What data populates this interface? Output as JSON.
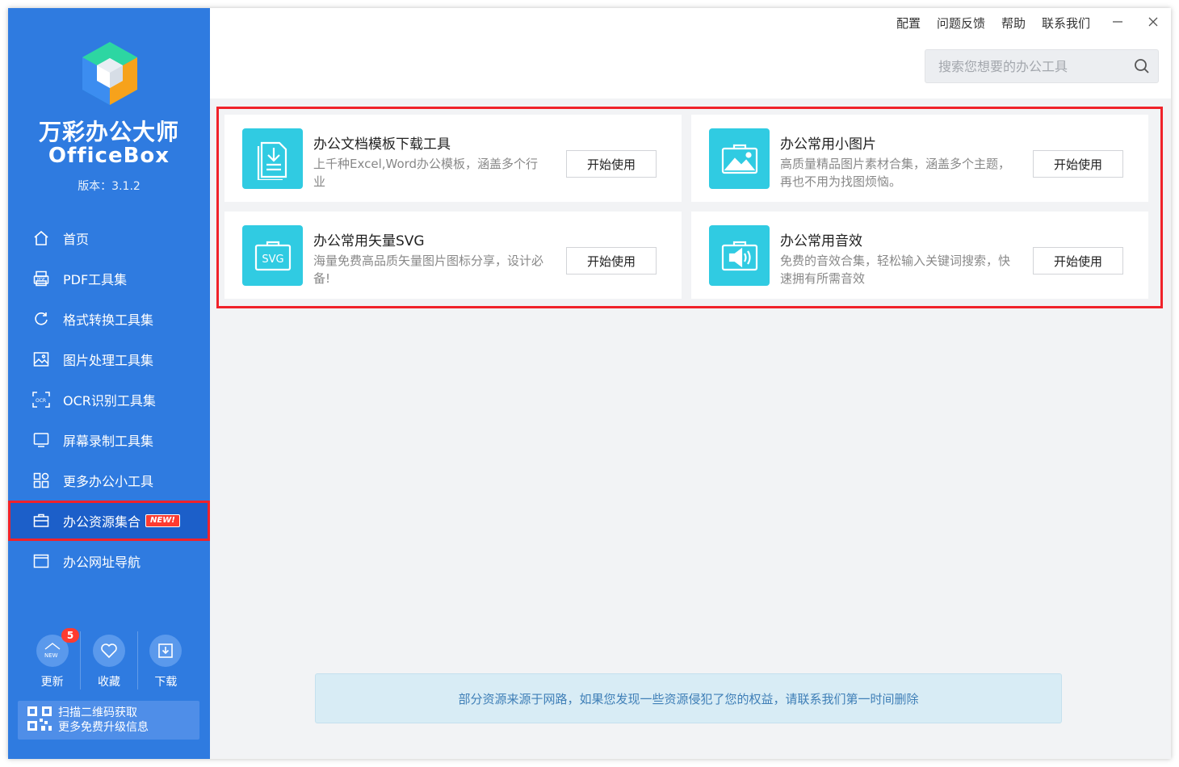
{
  "app": {
    "name_cn": "万彩办公大师",
    "name_en": "OfficeBox",
    "version": "版本：3.1.2"
  },
  "colors": {
    "sidebar": "#2f7be0",
    "sidebar_active": "#1c5fc9",
    "highlight_border": "#f0222a",
    "card_icon": "#30cbe2",
    "notice_bg": "#d8ecf5"
  },
  "sidebar": {
    "items": [
      {
        "label": "首页",
        "icon": "home-icon"
      },
      {
        "label": "PDF工具集",
        "icon": "pdf-icon"
      },
      {
        "label": "格式转换工具集",
        "icon": "convert-icon"
      },
      {
        "label": "图片处理工具集",
        "icon": "image-icon"
      },
      {
        "label": "OCR识别工具集",
        "icon": "ocr-icon"
      },
      {
        "label": "屏幕录制工具集",
        "icon": "screen-record-icon"
      },
      {
        "label": "更多办公小工具",
        "icon": "more-tools-icon"
      },
      {
        "label": "办公资源集合",
        "icon": "briefcase-icon",
        "active": true,
        "badge": "NEW!"
      },
      {
        "label": "办公网址导航",
        "icon": "browser-icon"
      }
    ],
    "bottom": {
      "update_label": "更新",
      "update_icon_text": "NEW",
      "update_count": "5",
      "favorite_label": "收藏",
      "download_label": "下载"
    },
    "qr": {
      "line1": "扫描二维码获取",
      "line2": "更多免费升级信息"
    }
  },
  "topbar": {
    "menu": [
      "配置",
      "问题反馈",
      "帮助",
      "联系我们"
    ],
    "search_placeholder": "搜索您想要的办公工具"
  },
  "cards": [
    {
      "title": "办公文档模板下载工具",
      "desc": "上千种Excel,Word办公模板，涵盖多个行业",
      "button": "开始使用",
      "icon": "document-download-icon"
    },
    {
      "title": "办公常用小图片",
      "desc": "高质量精品图片素材合集，涵盖多个主题，再也不用为找图烦恼。",
      "button": "开始使用",
      "icon": "picture-icon"
    },
    {
      "title": "办公常用矢量SVG",
      "desc": "海量免费高品质矢量图片图标分享，设计必备!",
      "button": "开始使用",
      "icon": "svg-icon",
      "icon_text": "SVG"
    },
    {
      "title": "办公常用音效",
      "desc": "免费的音效合集，轻松输入关键词搜索，快速拥有所需音效",
      "button": "开始使用",
      "icon": "speaker-icon"
    }
  ],
  "notice": "部分资源来源于网路，如果您发现一些资源侵犯了您的权益，请联系我们第一时间删除"
}
